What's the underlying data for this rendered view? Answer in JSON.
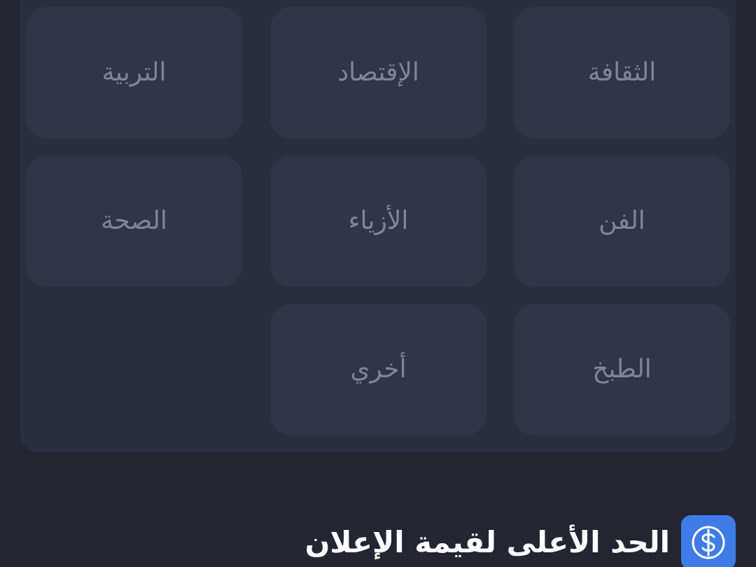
{
  "categories": [
    {
      "label": "الثقافة"
    },
    {
      "label": "الإقتصاد"
    },
    {
      "label": "التربية"
    },
    {
      "label": "الفن"
    },
    {
      "label": "الأزياء"
    },
    {
      "label": "الصحة"
    },
    {
      "label": "الطبخ"
    },
    {
      "label": "أخري"
    }
  ],
  "max_ad_value": {
    "title": "الحد الأعلى لقيمة الإعلان",
    "icon": "dollar-icon",
    "icon_color": "#3f7ce8"
  },
  "colors": {
    "background": "#222633",
    "panel": "#2a2f3e",
    "tile": "#303648",
    "tile_text": "#7f8595",
    "accent": "#3f7ce8"
  }
}
